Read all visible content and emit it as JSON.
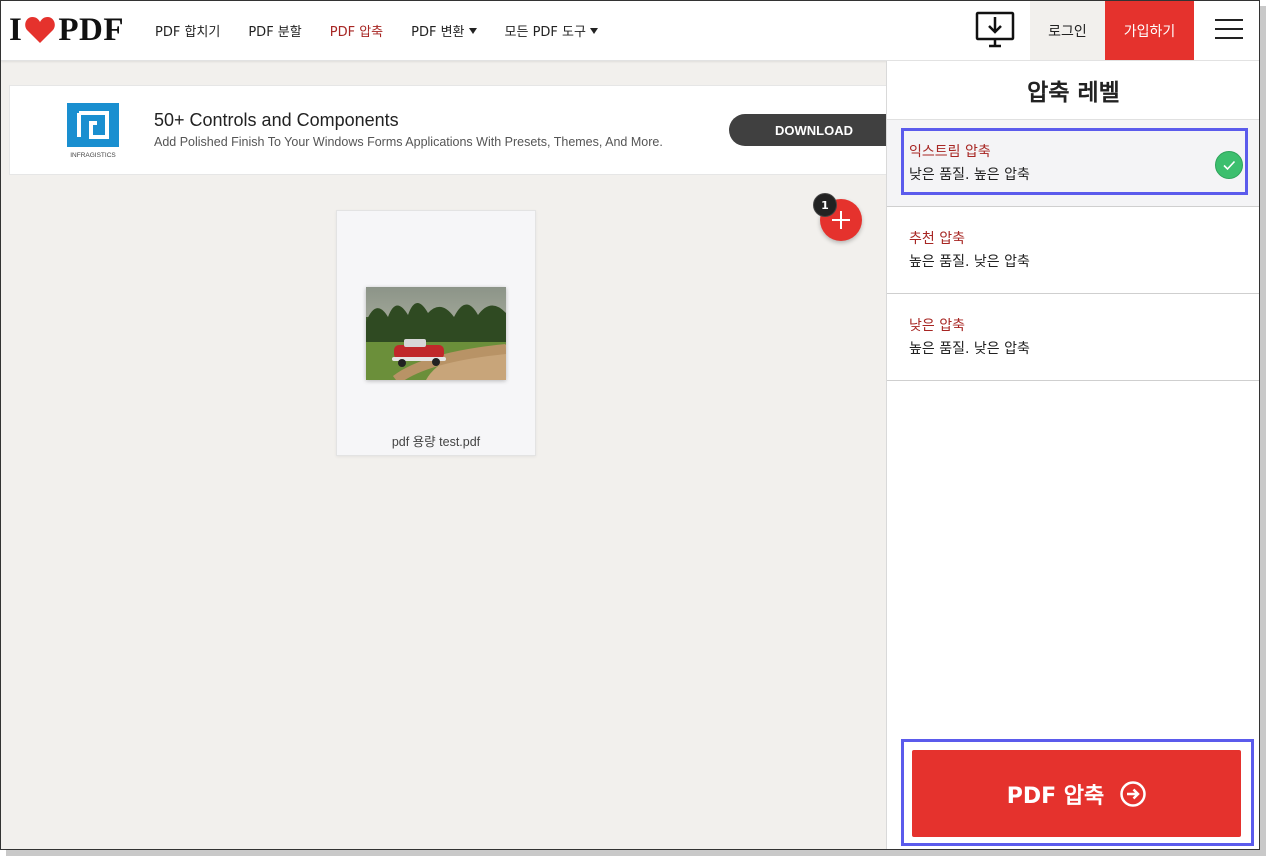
{
  "header": {
    "logo_left": "I",
    "logo_right": "PDF",
    "nav": [
      {
        "label": "PDF 합치기",
        "active": false,
        "dropdown": false
      },
      {
        "label": "PDF 분할",
        "active": false,
        "dropdown": false
      },
      {
        "label": "PDF 압축",
        "active": true,
        "dropdown": false
      },
      {
        "label": "PDF 변환",
        "active": false,
        "dropdown": true
      },
      {
        "label": "모든 PDF 도구",
        "active": false,
        "dropdown": true
      }
    ],
    "login_label": "로그인",
    "signup_label": "가입하기",
    "desktop_icon": "desktop-download-icon",
    "menu_icon": "hamburger-menu-icon"
  },
  "ad": {
    "brand": "INFRAGISTICS",
    "title": "50+ Controls and Components",
    "subtitle": "Add Polished Finish To Your Windows Forms Applications With Presets, Themes, And More.",
    "button_label": "DOWNLOAD"
  },
  "workspace": {
    "file_name": "pdf 용량 test.pdf",
    "file_count_badge": "1"
  },
  "sidebar": {
    "title": "압축 레벨",
    "options": [
      {
        "title": "익스트림 압축",
        "desc": "낮은 품질. 높은 압축",
        "selected": true
      },
      {
        "title": "추천 압축",
        "desc": "높은 품질. 낮은 압축",
        "selected": false
      },
      {
        "title": "낮은 압축",
        "desc": "높은 품질. 낮은 압축",
        "selected": false
      }
    ],
    "action_label": "PDF 압축"
  },
  "colors": {
    "brand_red": "#e5322d",
    "active_nav": "#a72623",
    "highlight": "#5b5bec",
    "check_green": "#3cbf6e"
  }
}
